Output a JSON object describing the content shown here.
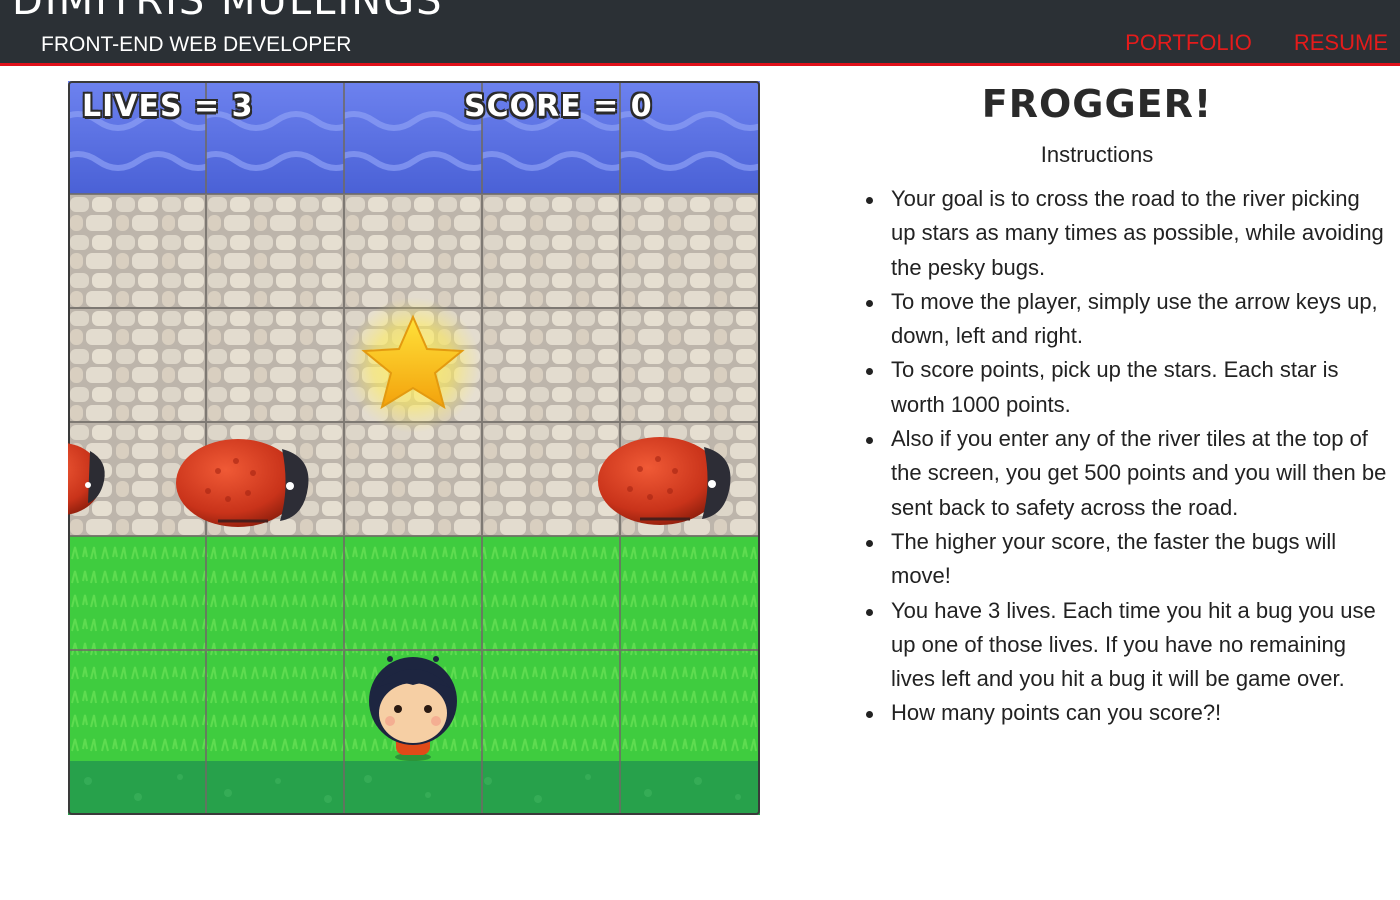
{
  "header": {
    "name": "DIMITRIS MULLINGS",
    "tagline": "FRONT-END WEB DEVELOPER",
    "nav": [
      {
        "label": "PORTFOLIO"
      },
      {
        "label": "RESUME"
      }
    ],
    "accent_color": "#e51b1b"
  },
  "game": {
    "lives_text": "LIVES = 3",
    "score_text": "SCORE = 0",
    "lives": 3,
    "score": 0,
    "grid": {
      "columns": 5,
      "rows": [
        "water",
        "stone",
        "stone",
        "stone",
        "grass",
        "grass"
      ]
    },
    "sprites": [
      "star-icon",
      "bug-enemy",
      "bug-enemy",
      "bug-enemy",
      "player-boy"
    ]
  },
  "panel": {
    "title": "FROGGER!",
    "subtitle": "Instructions",
    "rules": [
      "Your goal is to cross the road to the river picking up stars as many times as possible, while avoiding the pesky bugs.",
      "To move the player, simply use the arrow keys up, down, left and right.",
      "To score points, pick up the stars. Each star is worth 1000 points.",
      "Also if you enter any of the river tiles at the top of the screen, you get 500 points and you will then be sent back to safety across the road.",
      "The higher your score, the faster the bugs will move!",
      "You have 3 lives. Each time you hit a bug you use up one of those lives. If you have no remaining lives left and you hit a bug it will be game over.",
      "How many points can you score?!"
    ]
  }
}
